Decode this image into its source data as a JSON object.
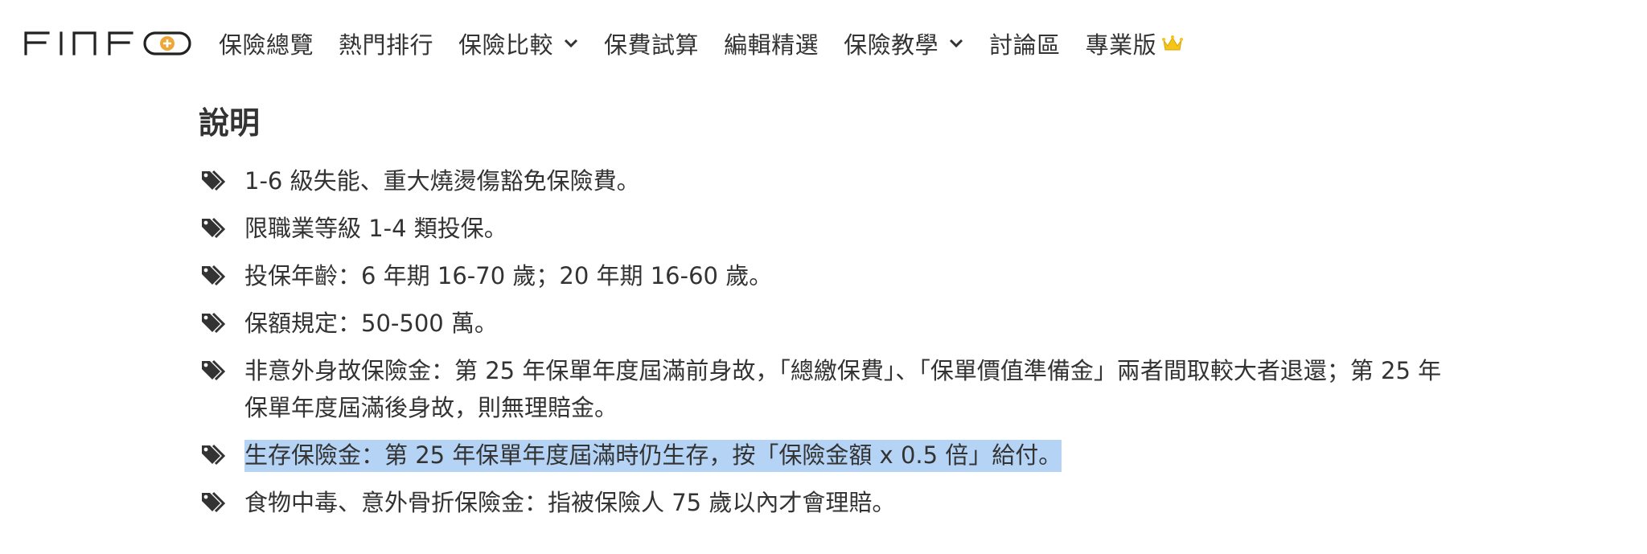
{
  "brand": {
    "logo_text": "FINFO",
    "accent_color": "#f0a73a"
  },
  "nav": {
    "items": [
      {
        "label": "保險總覽",
        "has_dropdown": false
      },
      {
        "label": "熱門排行",
        "has_dropdown": false
      },
      {
        "label": "保險比較",
        "has_dropdown": true
      },
      {
        "label": "保費試算",
        "has_dropdown": false
      },
      {
        "label": "編輯精選",
        "has_dropdown": false
      },
      {
        "label": "保險教學",
        "has_dropdown": true
      },
      {
        "label": "討論區",
        "has_dropdown": false
      },
      {
        "label": "專業版",
        "has_dropdown": false,
        "icon": "crown-icon"
      }
    ]
  },
  "section": {
    "title": "說明",
    "icon": "tags-icon",
    "highlight_color": "#b5d4f5",
    "items": [
      {
        "text": "1-6 級失能、重大燒燙傷豁免保險費。",
        "highlighted": false
      },
      {
        "text": "限職業等級 1-4 類投保。",
        "highlighted": false
      },
      {
        "text": "投保年齡：6 年期 16-70 歲；20 年期 16-60 歲。",
        "highlighted": false
      },
      {
        "text": "保額規定：50-500 萬。",
        "highlighted": false
      },
      {
        "text": "非意外身故保險金：第 25 年保單年度屆滿前身故，「總繳保費」、「保單價值準備金」兩者間取較大者退還；第 25 年保單年度屆滿後身故，則無理賠金。",
        "highlighted": false
      },
      {
        "text": "生存保險金：第 25 年保單年度屆滿時仍生存，按「保險金額 x 0.5 倍」給付。",
        "highlighted": true
      },
      {
        "text": "食物中毒、意外骨折保險金：指被保險人 75 歲以內才會理賠。",
        "highlighted": false
      }
    ]
  }
}
